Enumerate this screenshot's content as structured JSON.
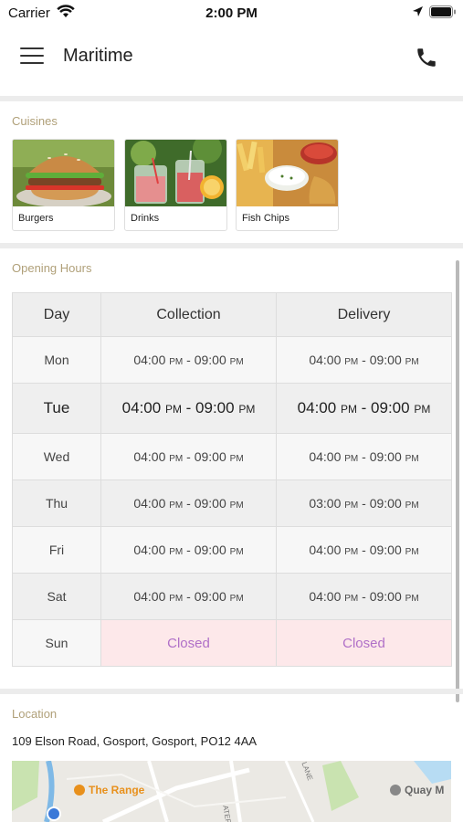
{
  "status_bar": {
    "carrier": "Carrier",
    "time": "2:00 PM"
  },
  "header": {
    "title": "Maritime",
    "menu_icon": "hamburger-menu-icon",
    "phone_icon": "phone-icon"
  },
  "cuisines": {
    "label": "Cuisines",
    "items": [
      {
        "name": "Burgers",
        "image": "burger-photo"
      },
      {
        "name": "Drinks",
        "image": "drinks-photo"
      },
      {
        "name": "Fish  Chips",
        "image": "fish-chips-photo"
      }
    ]
  },
  "opening_hours": {
    "label": "Opening Hours",
    "headers": [
      "Day",
      "Collection",
      "Delivery"
    ],
    "period_suffix": "PM",
    "rows": [
      {
        "day": "Mon",
        "collection_from": "04:00",
        "collection_to": "09:00",
        "delivery_from": "04:00",
        "delivery_to": "09:00"
      },
      {
        "day": "Tue",
        "collection_from": "04:00",
        "collection_to": "09:00",
        "delivery_from": "04:00",
        "delivery_to": "09:00"
      },
      {
        "day": "Wed",
        "collection_from": "04:00",
        "collection_to": "09:00",
        "delivery_from": "04:00",
        "delivery_to": "09:00"
      },
      {
        "day": "Thu",
        "collection_from": "04:00",
        "collection_to": "09:00",
        "delivery_from": "03:00",
        "delivery_to": "09:00"
      },
      {
        "day": "Fri",
        "collection_from": "04:00",
        "collection_to": "09:00",
        "delivery_from": "04:00",
        "delivery_to": "09:00"
      },
      {
        "day": "Sat",
        "collection_from": "04:00",
        "collection_to": "09:00",
        "delivery_from": "04:00",
        "delivery_to": "09:00"
      },
      {
        "day": "Sun",
        "collection": "Closed",
        "delivery": "Closed"
      }
    ]
  },
  "location": {
    "label": "Location",
    "address": "109 Elson Road, Gosport, Gosport, PO12 4AA",
    "map": {
      "poi_1": "The Range",
      "poi_2": "Quay M",
      "street_1": "ATER LANE",
      "street_2": "LANE"
    }
  },
  "colors": {
    "section_label": "#b0a079",
    "closed_bg": "#fde8ea",
    "closed_text": "#b070c8",
    "poi_orange": "#e8901c"
  }
}
